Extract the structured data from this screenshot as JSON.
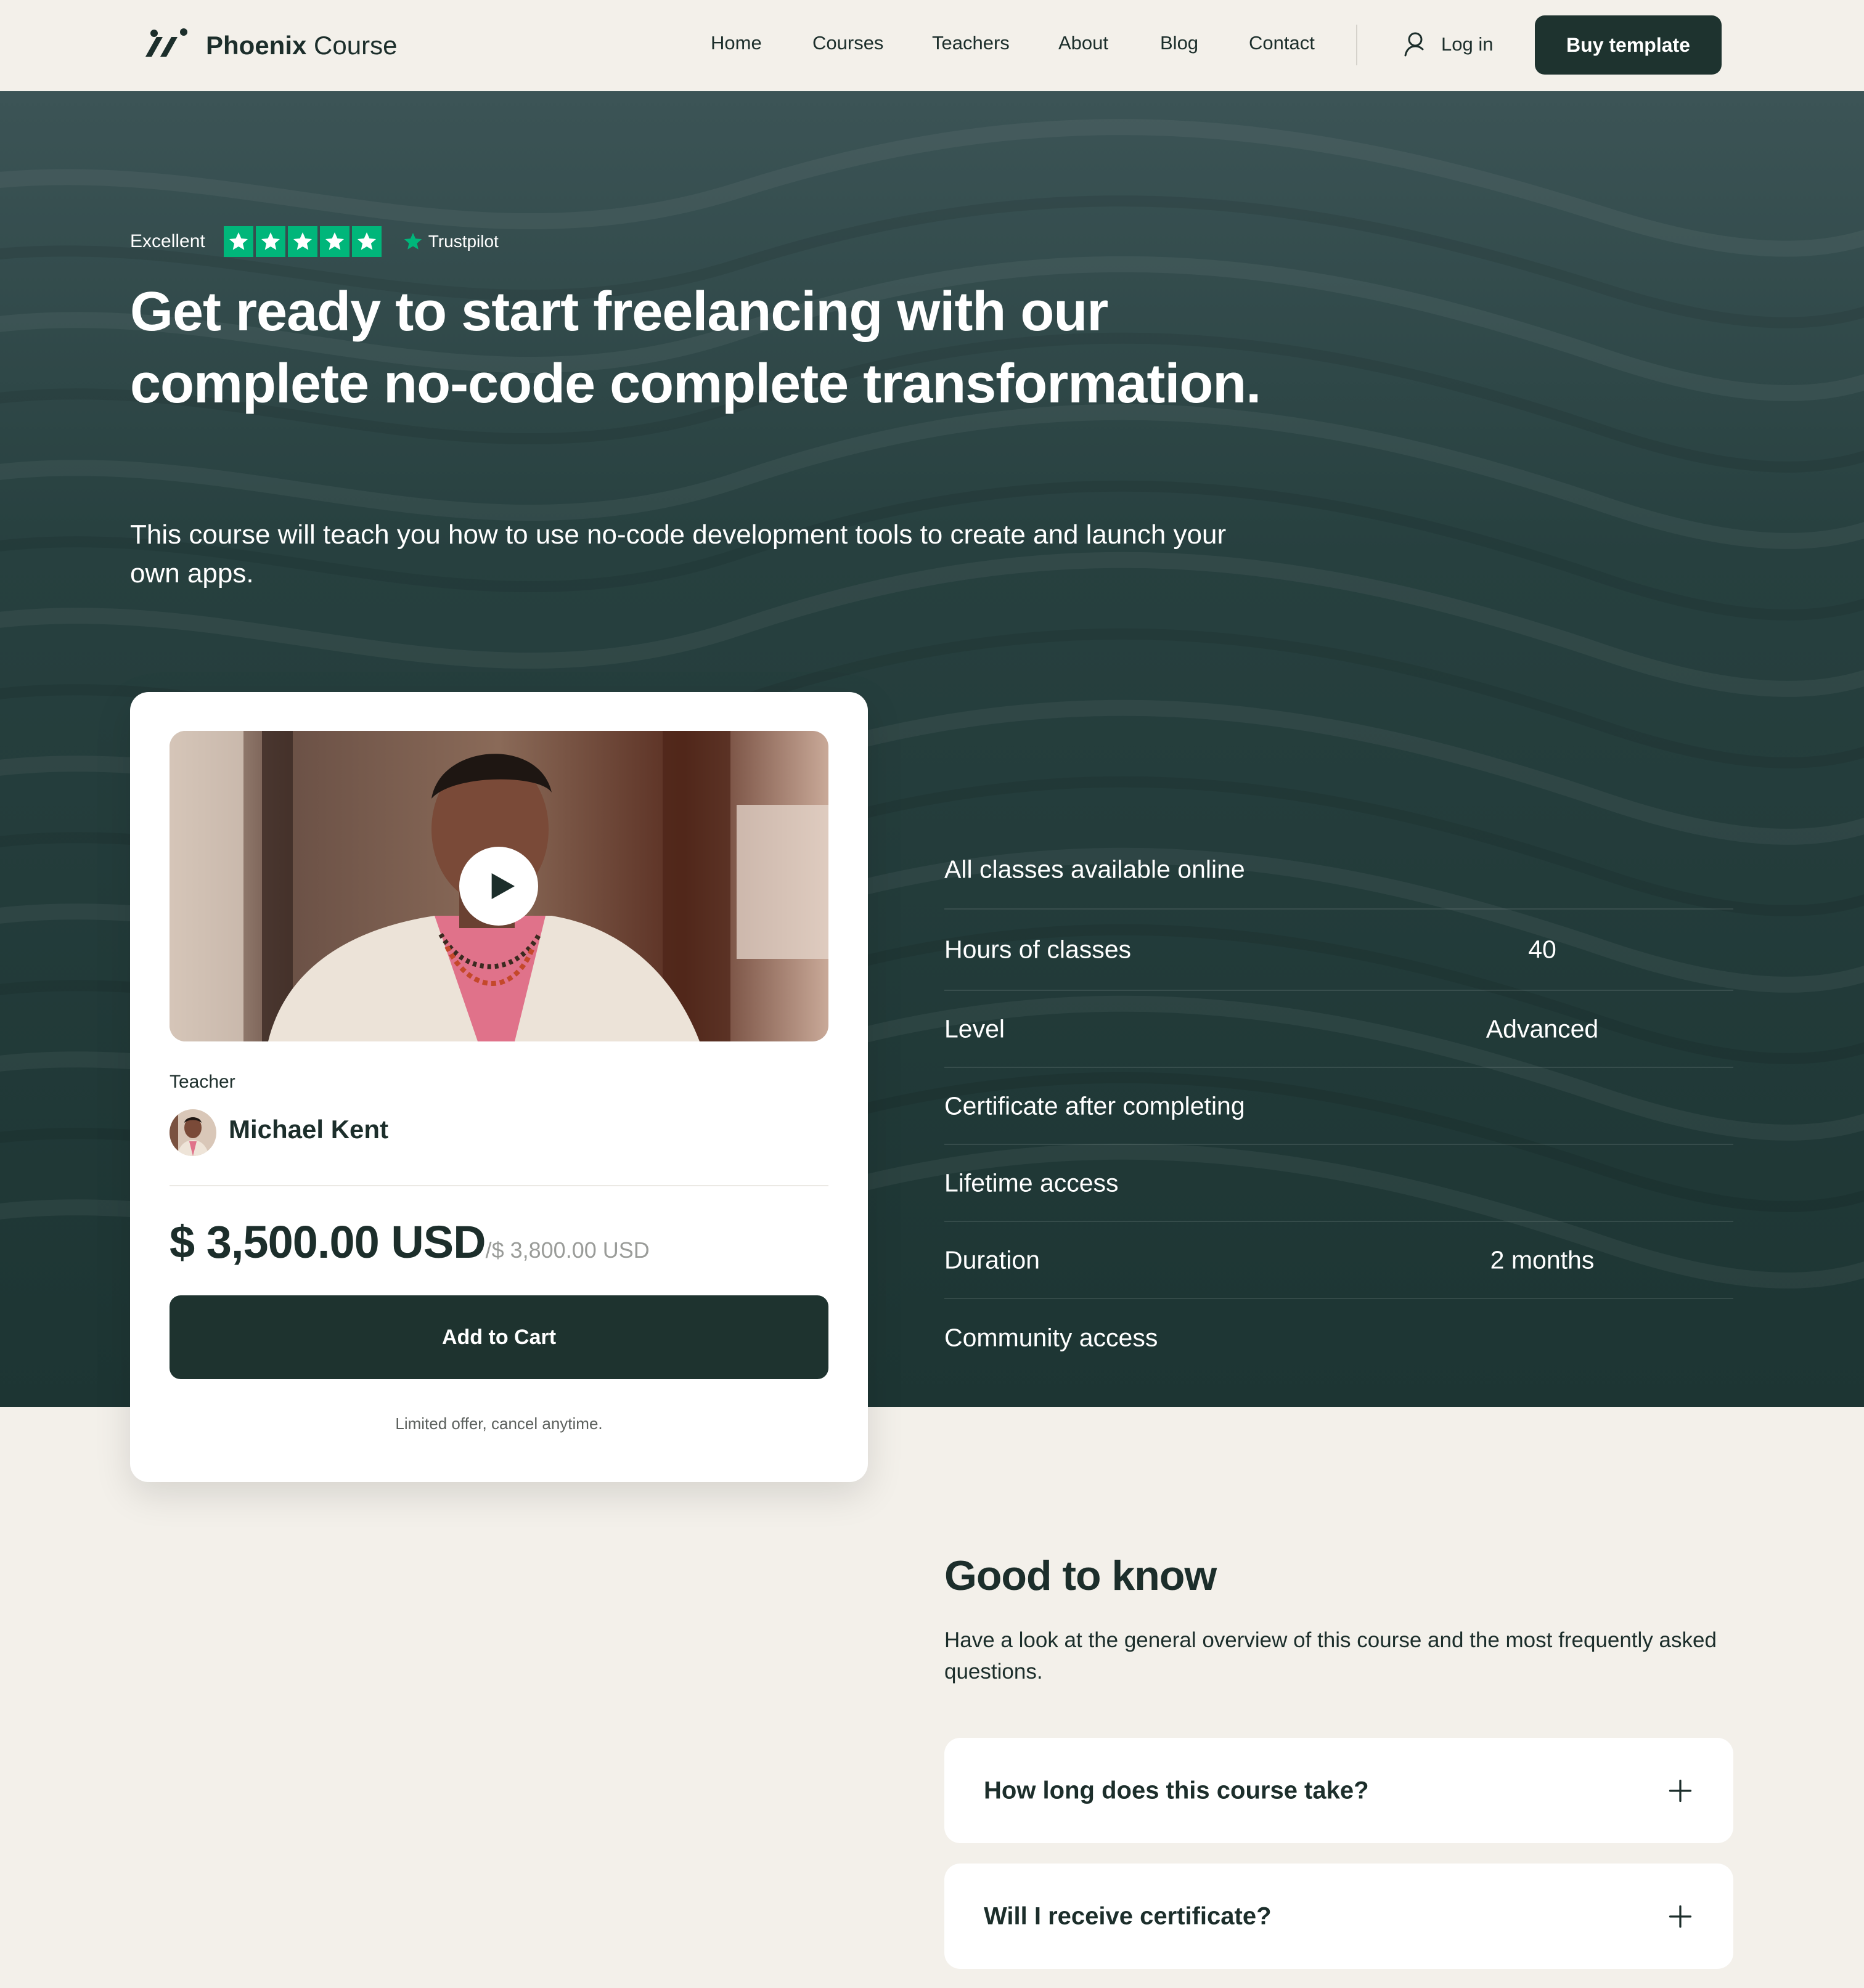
{
  "nav": {
    "brand_bold": "Phoenix",
    "brand_light": "Course",
    "links": [
      "Home",
      "Courses",
      "Teachers",
      "About",
      "Blog",
      "Contact"
    ],
    "login_label": "Log in",
    "buy_label": "Buy template"
  },
  "hero": {
    "rating_label": "Excellent",
    "star_count": 5,
    "trustpilot_label": "Trustpilot",
    "title": "Get ready to start freelancing with our complete no-code complete transformation.",
    "subtitle": "This course will teach you how to use no-code development tools to create and launch your own apps."
  },
  "card": {
    "teacher_label": "Teacher",
    "teacher_name": "Michael Kent",
    "price": "$ 3,500.00 USD",
    "old_price": "/$ 3,800.00 USD",
    "cart_label": "Add to Cart",
    "note": "Limited offer, cancel anytime."
  },
  "features": [
    {
      "label": "All classes available online",
      "value": "",
      "check": true
    },
    {
      "label": "Hours of classes",
      "value": "40",
      "check": false
    },
    {
      "label": "Level",
      "value": "Advanced",
      "check": false
    },
    {
      "label": "Certificate after completing",
      "value": "",
      "check": true
    },
    {
      "label": "Lifetime access",
      "value": "",
      "check": true
    },
    {
      "label": "Duration",
      "value": "2 months",
      "check": false
    },
    {
      "label": "Community access",
      "value": "",
      "check": true
    }
  ],
  "good_to_know": {
    "title": "Good to know",
    "subtitle": "Have a look at the general overview of this course and the most frequently asked questions.",
    "faqs": [
      "How long does this course take?",
      "Will I receive certificate?"
    ]
  },
  "colors": {
    "accent_dark": "#1e332f",
    "hero_bg": "#22383a",
    "page_bg": "#f3f0ea",
    "trustpilot_green": "#00b67a"
  },
  "icons": {
    "logo": "phoenix-slash-logo",
    "login": "user-icon",
    "play": "play-icon",
    "check": "check-icon",
    "faq": "plus-icon",
    "star": "star-icon"
  }
}
